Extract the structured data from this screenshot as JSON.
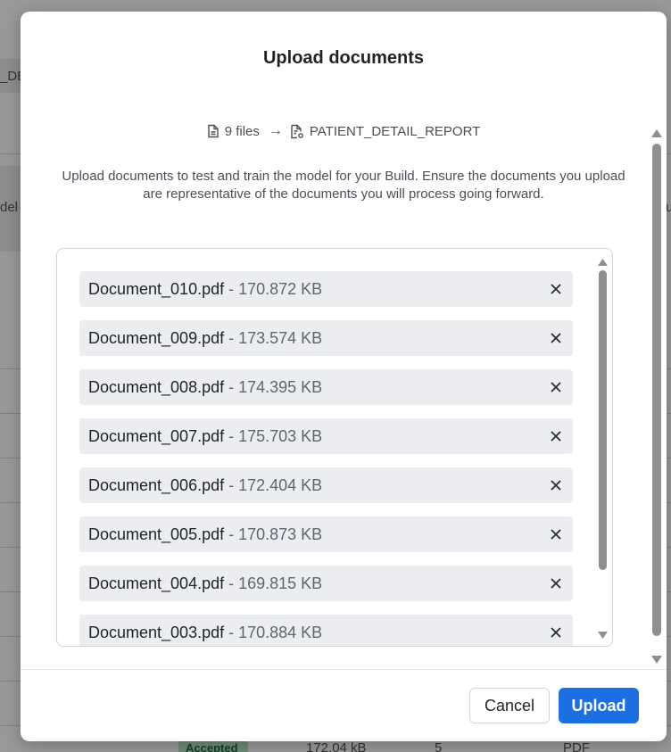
{
  "background": {
    "left_fragment_top": "_DE",
    "left_fragment_mid": "del",
    "right_fragment_mid": "u",
    "bottom_badge": "Accepted",
    "bottom_size": "172.04 kB",
    "bottom_count": "5",
    "bottom_type": "PDF"
  },
  "modal": {
    "title": "Upload documents",
    "summary": {
      "file_count_label": "9 files",
      "arrow": "→",
      "target_name": "PATIENT_DETAIL_REPORT"
    },
    "description": "Upload documents to test and train the model for your Build. Ensure the documents you upload are representative of the documents you will process going forward.",
    "files": [
      {
        "name": "Document_010.pdf",
        "size": "- 170.872 KB"
      },
      {
        "name": "Document_009.pdf",
        "size": "- 173.574 KB"
      },
      {
        "name": "Document_008.pdf",
        "size": "- 174.395 KB"
      },
      {
        "name": "Document_007.pdf",
        "size": "- 175.703 KB"
      },
      {
        "name": "Document_006.pdf",
        "size": "- 172.404 KB"
      },
      {
        "name": "Document_005.pdf",
        "size": "- 170.873 KB"
      },
      {
        "name": "Document_004.pdf",
        "size": "- 169.815 KB"
      },
      {
        "name": "Document_003.pdf",
        "size": "- 170.884 KB"
      }
    ],
    "cancel_label": "Cancel",
    "upload_label": "Upload"
  },
  "colors": {
    "primary": "#1b6fe0",
    "file_chip_bg": "#ebedf0",
    "overlay": "rgba(0,0,0,0.40)"
  },
  "icons": {
    "file": "file-icon",
    "target": "document-settings-icon",
    "remove": "close-icon"
  }
}
